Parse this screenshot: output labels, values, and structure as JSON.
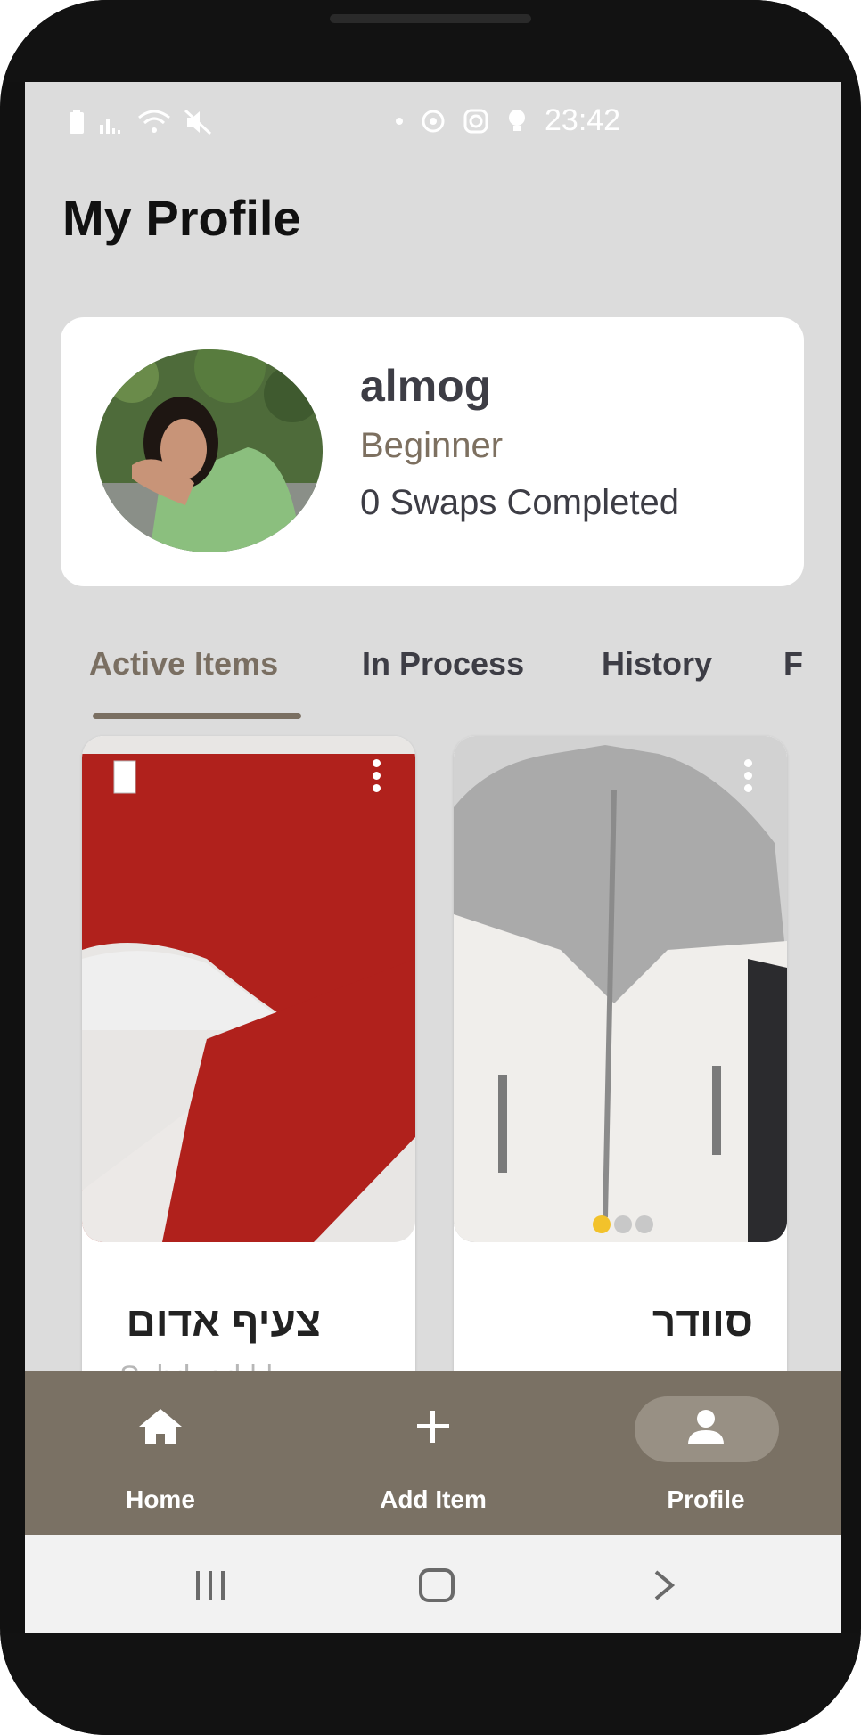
{
  "status_bar": {
    "time": "23:42"
  },
  "page": {
    "title": "My Profile"
  },
  "profile": {
    "name": "almog",
    "level": "Beginner",
    "swaps": "0 Swaps Completed"
  },
  "tabs": [
    {
      "label": "Active Items",
      "active": true
    },
    {
      "label": "In Process",
      "active": false
    },
    {
      "label": "History",
      "active": false
    },
    {
      "label": "F",
      "active": false
    }
  ],
  "items": [
    {
      "title": "צעיף אדום",
      "subtitle": "Subdued | |"
    },
    {
      "title": "סוודר"
    }
  ],
  "bottom_nav": [
    {
      "label": "Home",
      "icon": "home-icon"
    },
    {
      "label": "Add Item",
      "icon": "plus-icon"
    },
    {
      "label": "Profile",
      "icon": "person-icon",
      "active": true
    }
  ],
  "colors": {
    "accent": "#7a6f62",
    "nav_bg": "#7a7164",
    "screen_bg": "#dcdcdc",
    "dot_active": "#f2c22b"
  }
}
